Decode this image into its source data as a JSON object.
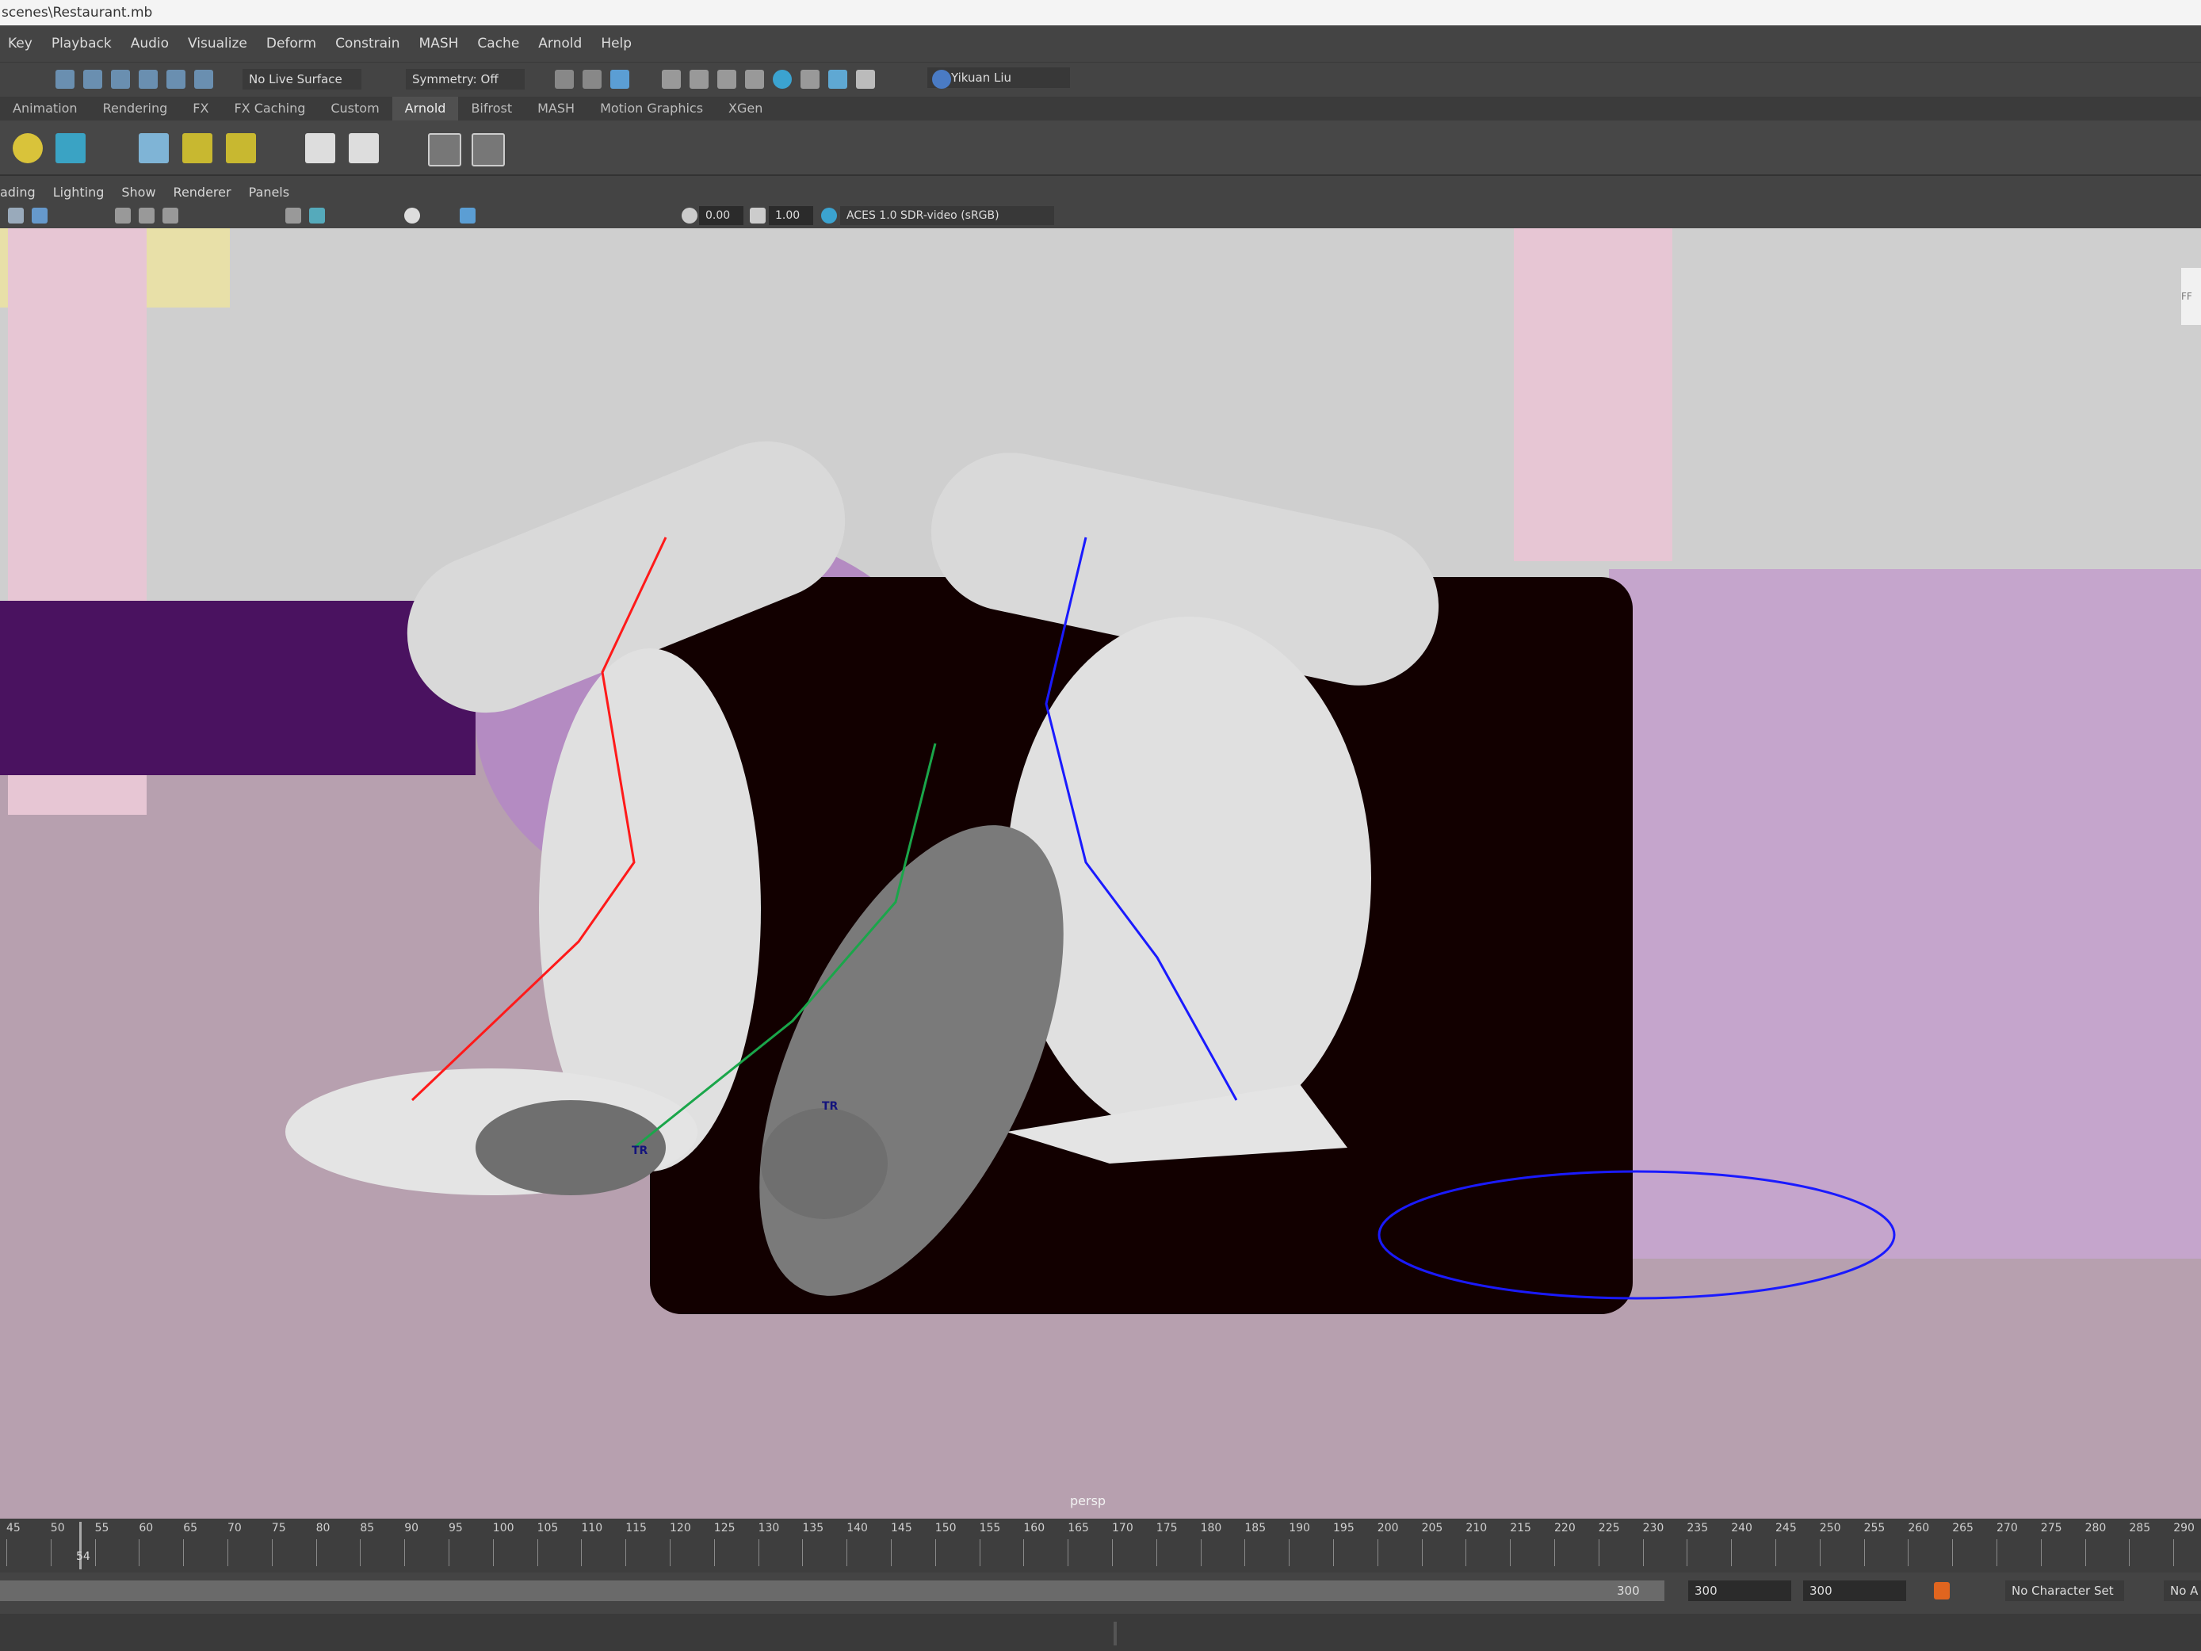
{
  "title": {
    "path": "scenes\\Restaurant.mb"
  },
  "menus": [
    "Key",
    "Playback",
    "Audio",
    "Visualize",
    "Deform",
    "Constrain",
    "MASH",
    "Cache",
    "Arnold",
    "Help"
  ],
  "status": {
    "live_surface": "No Live Surface",
    "symmetry": "Symmetry: Off",
    "user": "Yikuan Liu"
  },
  "shelf_tabs": [
    "Animation",
    "Rendering",
    "FX",
    "FX Caching",
    "Custom",
    "Arnold",
    "Bifrost",
    "MASH",
    "Motion Graphics",
    "XGen"
  ],
  "active_shelf_tab": "Arnold",
  "panel_menus": [
    "ading",
    "Lighting",
    "Show",
    "Renderer",
    "Panels"
  ],
  "panel_tools": {
    "exposure": "0.00",
    "gamma": "1.00",
    "color_space": "ACES 1.0 SDR-video (sRGB)"
  },
  "viewport": {
    "camera": "persp",
    "fr_label": "FF",
    "tr_labels": [
      "TR",
      "TR"
    ]
  },
  "timeline": {
    "ticks": [
      "45",
      "50",
      "55",
      "60",
      "65",
      "70",
      "75",
      "80",
      "85",
      "90",
      "95",
      "100",
      "105",
      "110",
      "115",
      "120",
      "125",
      "130",
      "135",
      "140",
      "145",
      "150",
      "155",
      "160",
      "165",
      "170",
      "175",
      "180",
      "185",
      "190",
      "195",
      "200",
      "205",
      "210",
      "215",
      "220",
      "225",
      "230",
      "235",
      "240",
      "245",
      "250",
      "255",
      "260",
      "265",
      "270",
      "275",
      "280",
      "285",
      "290"
    ],
    "current_frame": "54"
  },
  "range": {
    "range_end": "300",
    "end_time": "300",
    "end_frame": "300",
    "character_set": "No Character Set",
    "anim_layer": "No A"
  },
  "colors": {
    "rig_red": "#ff1a1a",
    "rig_blue": "#1a1aff",
    "rig_green": "#1aa64a",
    "floor": "#b7a0af",
    "panel": "#444444"
  }
}
